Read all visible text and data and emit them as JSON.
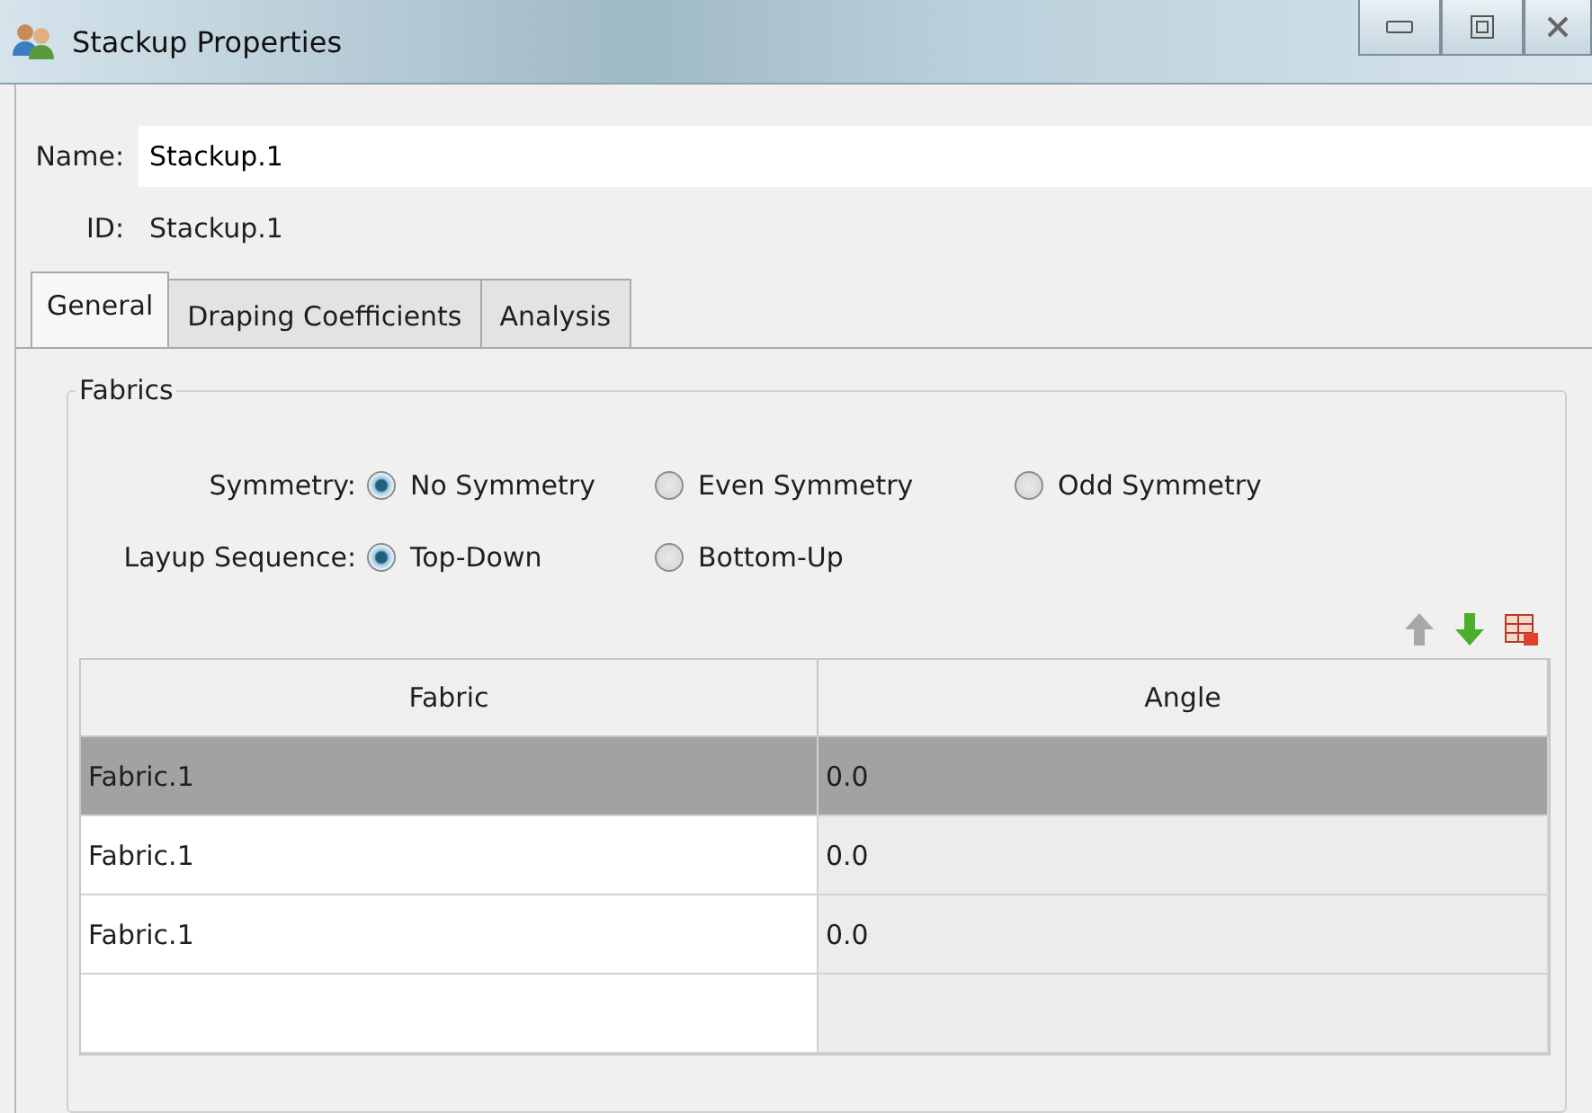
{
  "window": {
    "title": "Stackup Properties"
  },
  "name": {
    "label": "Name:",
    "value": "Stackup.1"
  },
  "id": {
    "label": "ID:",
    "value": "Stackup.1"
  },
  "tabs": [
    {
      "label": "General",
      "selected": true
    },
    {
      "label": "Draping Coefficients",
      "selected": false
    },
    {
      "label": "Analysis",
      "selected": false
    }
  ],
  "group": {
    "title": "Fabrics"
  },
  "radio_groups": [
    {
      "label": "Symmetry:",
      "options": [
        {
          "label": "No Symmetry",
          "selected": true
        },
        {
          "label": "Even Symmetry",
          "selected": false
        },
        {
          "label": "Odd Symmetry",
          "selected": false
        }
      ]
    },
    {
      "label": "Layup Sequence:",
      "options": [
        {
          "label": "Top-Down",
          "selected": true
        },
        {
          "label": "Bottom-Up",
          "selected": false
        }
      ]
    }
  ],
  "table": {
    "columns": [
      "Fabric",
      "Angle"
    ],
    "rows": [
      {
        "cells": [
          "Fabric.1",
          "0.0"
        ],
        "selected": true
      },
      {
        "cells": [
          "Fabric.1",
          "0.0"
        ],
        "selected": false
      },
      {
        "cells": [
          "Fabric.1",
          "0.0"
        ],
        "selected": false
      },
      {
        "cells": [
          "",
          ""
        ],
        "selected": false
      }
    ]
  }
}
